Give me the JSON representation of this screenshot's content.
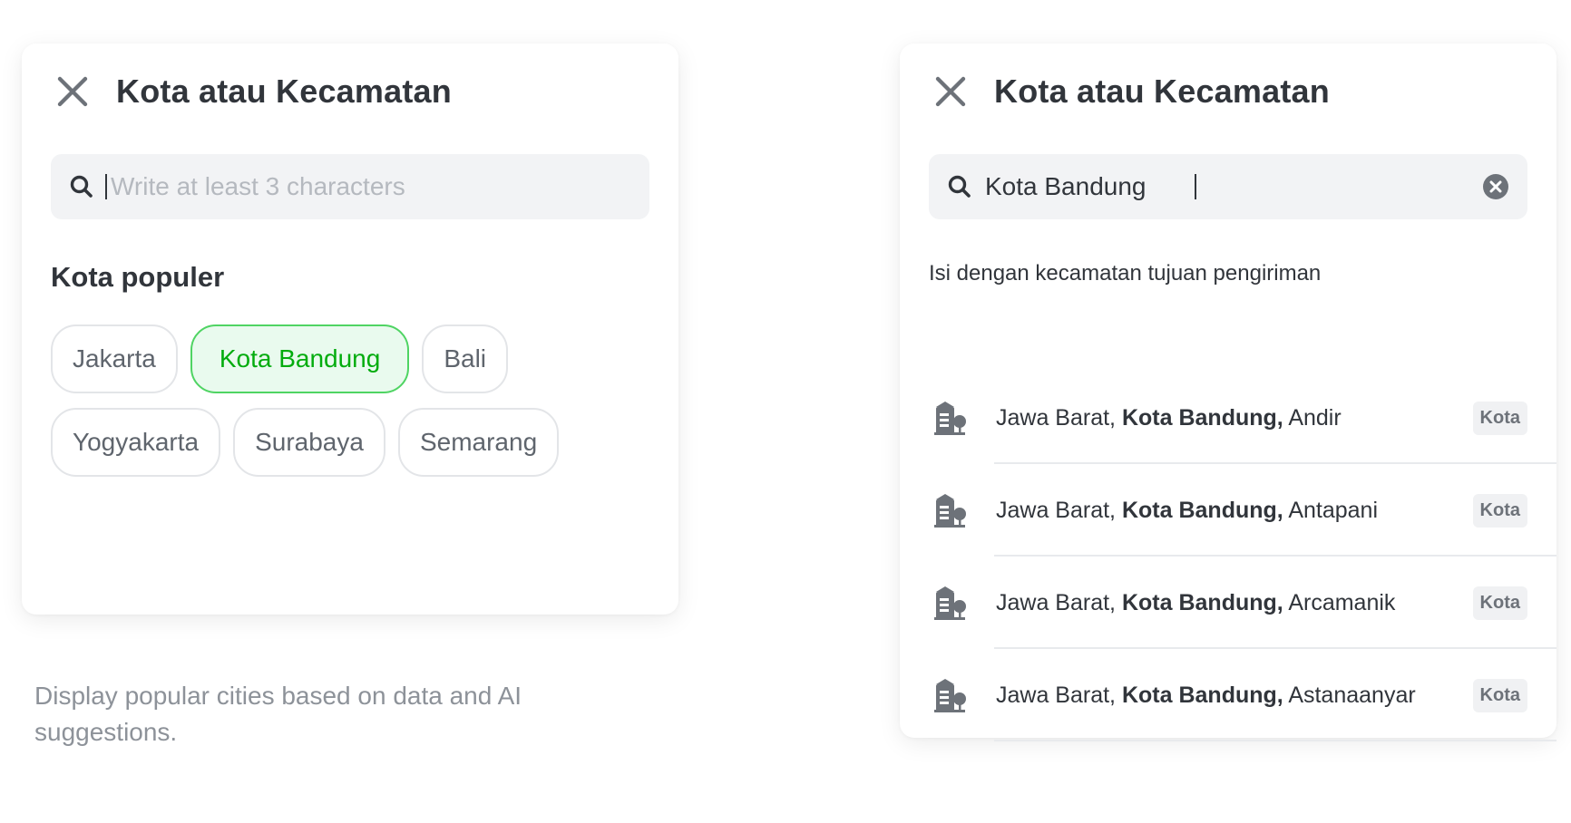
{
  "left_panel": {
    "title": "Kota atau Kecamatan",
    "search": {
      "placeholder": "Write at least 3 characters",
      "value": ""
    },
    "section_title": "Kota populer",
    "chips": [
      {
        "label": "Jakarta",
        "selected": false
      },
      {
        "label": "Kota Bandung",
        "selected": true
      },
      {
        "label": "Bali",
        "selected": false
      },
      {
        "label": "Yogyakarta",
        "selected": false
      },
      {
        "label": "Surabaya",
        "selected": false
      },
      {
        "label": "Semarang",
        "selected": false
      }
    ]
  },
  "caption": "Display popular cities based on data and AI suggestions.",
  "right_panel": {
    "title": "Kota atau Kecamatan",
    "search": {
      "value": "Kota Bandung"
    },
    "hint": "Isi dengan kecamatan tujuan pengiriman",
    "results": [
      {
        "province": "Jawa Barat,",
        "city": "Kota Bandung,",
        "district": "Andir",
        "badge": "Kota"
      },
      {
        "province": "Jawa Barat,",
        "city": "Kota Bandung,",
        "district": "Antapani",
        "badge": "Kota"
      },
      {
        "province": "Jawa Barat,",
        "city": "Kota Bandung,",
        "district": "Arcamanik",
        "badge": "Kota"
      },
      {
        "province": "Jawa Barat,",
        "city": "Kota Bandung,",
        "district": "Astanaanyar",
        "badge": "Kota"
      }
    ]
  },
  "icons": {
    "close": "close-icon",
    "search": "search-icon",
    "clear": "clear-circle-icon",
    "result": "city-building-icon"
  },
  "colors": {
    "accent_green": "#03ac0e",
    "chip_border_selected": "#4fd463",
    "chip_bg_selected": "#e9faee",
    "text_primary": "#31353b",
    "text_muted": "#8d9299",
    "search_bg": "#f2f3f5"
  }
}
